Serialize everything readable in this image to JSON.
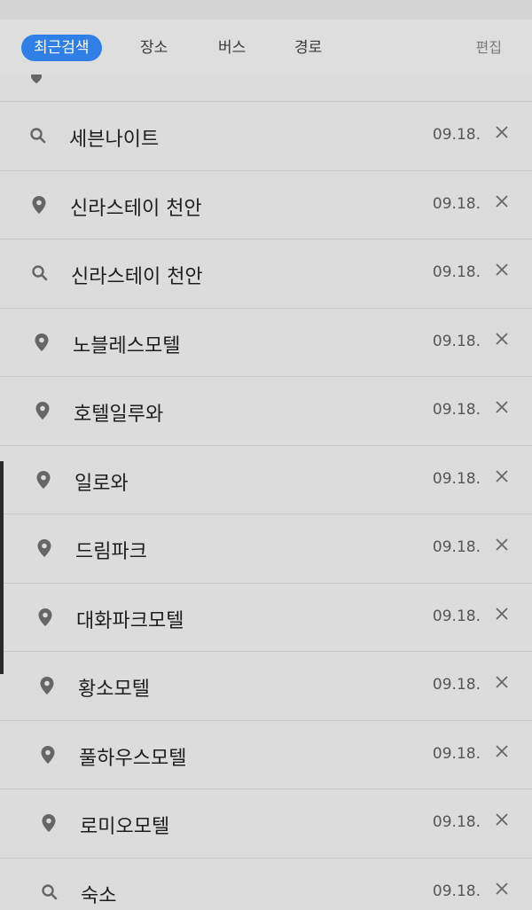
{
  "tabs": [
    {
      "label": "최근검색",
      "active": true
    },
    {
      "label": "장소",
      "active": false
    },
    {
      "label": "버스",
      "active": false
    },
    {
      "label": "경로",
      "active": false
    }
  ],
  "edit_label": "편집",
  "colors": {
    "accent": "#2f7fe6",
    "icon": "#666666",
    "background": "#dcdcdc"
  },
  "history": [
    {
      "icon": "search-icon",
      "label": "세븐나이트",
      "date": "09.18."
    },
    {
      "icon": "location-pin-icon",
      "label": "신라스테이 천안",
      "date": "09.18."
    },
    {
      "icon": "search-icon",
      "label": "신라스테이 천안",
      "date": "09.18."
    },
    {
      "icon": "location-pin-icon",
      "label": "노블레스모텔",
      "date": "09.18."
    },
    {
      "icon": "location-pin-icon",
      "label": "호텔일루와",
      "date": "09.18."
    },
    {
      "icon": "location-pin-icon",
      "label": "일로와",
      "date": "09.18."
    },
    {
      "icon": "location-pin-icon",
      "label": "드림파크",
      "date": "09.18."
    },
    {
      "icon": "location-pin-icon",
      "label": "대화파크모텔",
      "date": "09.18."
    },
    {
      "icon": "location-pin-icon",
      "label": "황소모텔",
      "date": "09.18."
    },
    {
      "icon": "location-pin-icon",
      "label": "풀하우스모텔",
      "date": "09.18."
    },
    {
      "icon": "location-pin-icon",
      "label": "로미오모텔",
      "date": "09.18."
    },
    {
      "icon": "search-icon",
      "label": "숙소",
      "date": "09.18."
    }
  ]
}
